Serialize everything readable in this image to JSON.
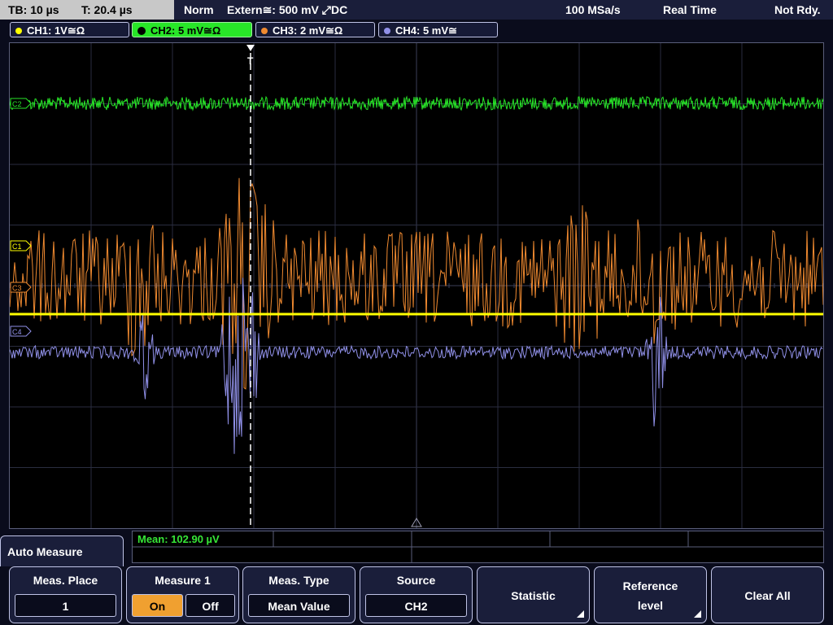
{
  "status": {
    "timebase": "TB: 10 µs",
    "trigger_time": "T: 20.4 µs",
    "mode": "Norm",
    "trigger_source": "Extern≅: 500 mV ⤢DC",
    "sample_rate": "100 MSa/s",
    "acq_mode": "Real Time",
    "state": "Not Rdy."
  },
  "channels": [
    {
      "label": "CH1: 1V≅Ω",
      "color": "#ffff00",
      "active": false
    },
    {
      "label": "CH2: 5 mV≅Ω",
      "color": "#28e628",
      "active": true
    },
    {
      "label": "CH3: 2 mV≅Ω",
      "color": "#f08a30",
      "active": false
    },
    {
      "label": "CH4: 5 mV≅",
      "color": "#9090e8",
      "active": false
    }
  ],
  "markers": {
    "c1": "C1",
    "c2": "C2",
    "c3": "C3",
    "c4": "C4",
    "trigger": "T"
  },
  "measurement": {
    "mean": "Mean: 102.90 µV"
  },
  "menu": {
    "title": "Auto Measure",
    "meas_place_label": "Meas. Place",
    "meas_place_value": "1",
    "measure_label": "Measure 1",
    "on_label": "On",
    "off_label": "Off",
    "meas_type_label": "Meas. Type",
    "meas_type_value": "Mean Value",
    "source_label": "Source",
    "source_value": "CH2",
    "statistic_label": "Statistic",
    "reference_label": "Reference level",
    "clear_label": "Clear All"
  },
  "colors": {
    "ch1": "#ffff00",
    "ch2": "#28e628",
    "ch3": "#f08a30",
    "ch4": "#9090e8",
    "grid": "#5a5e7a"
  }
}
